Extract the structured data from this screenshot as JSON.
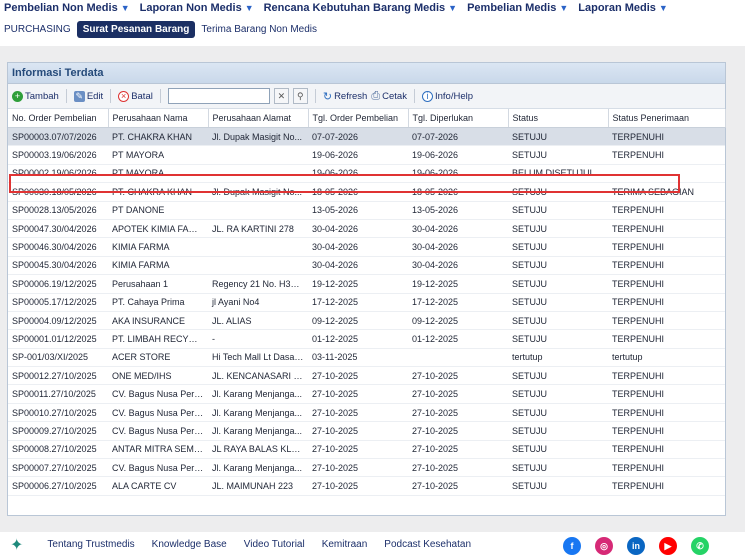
{
  "topnav": [
    {
      "label": "Pembelian Non Medis"
    },
    {
      "label": "Laporan Non Medis"
    },
    {
      "label": "Rencana Kebutuhan Barang Medis"
    },
    {
      "label": "Pembelian Medis"
    },
    {
      "label": "Laporan Medis"
    }
  ],
  "subnav": {
    "purchasing": "PURCHASING",
    "active": "Surat Pesanan Barang",
    "other": "Terima Barang Non Medis"
  },
  "panel": {
    "title": "Informasi Terdata"
  },
  "toolbar": {
    "add": "Tambah",
    "edit": "Edit",
    "cancel": "Batal",
    "search_value": "",
    "refresh": "Refresh",
    "print": "Cetak",
    "info": "Info/Help"
  },
  "table": {
    "headers": [
      "No. Order Pembelian",
      "Perusahaan Nama",
      "Perusahaan Alamat",
      "Tgl. Order Pembelian",
      "Tgl. Diperlukan",
      "Status",
      "Status Penerimaan"
    ],
    "rows": [
      [
        "SP00003.07/07/2026",
        "PT. CHAKRA KHAN",
        "Jl. Dupak Masigit No...",
        "07-07-2026",
        "07-07-2026",
        "SETUJU",
        "TERPENUHI"
      ],
      [
        "SP00003.19/06/2026",
        "PT MAYORA",
        "",
        "19-06-2026",
        "19-06-2026",
        "SETUJU",
        "TERPENUHI"
      ],
      [
        "SP00002.19/06/2026",
        "PT MAYORA",
        "",
        "19-06-2026",
        "19-06-2026",
        "BELUM DISETUJUI",
        ""
      ],
      [
        "SP00030.18/05/2026",
        "PT. CHAKRA KHAN",
        "Jl. Dupak Masigit No...",
        "18-05-2026",
        "18-05-2026",
        "SETUJU",
        "TERIMA SEBAGIAN"
      ],
      [
        "SP00028.13/05/2026",
        "PT DANONE",
        "",
        "13-05-2026",
        "13-05-2026",
        "SETUJU",
        "TERPENUHI"
      ],
      [
        "SP00047.30/04/2026",
        "APOTEK KIMIA FARMA",
        "JL. RA KARTINI 278",
        "30-04-2026",
        "30-04-2026",
        "SETUJU",
        "TERPENUHI"
      ],
      [
        "SP00046.30/04/2026",
        "KIMIA FARMA",
        "",
        "30-04-2026",
        "30-04-2026",
        "SETUJU",
        "TERPENUHI"
      ],
      [
        "SP00045.30/04/2026",
        "KIMIA FARMA",
        "",
        "30-04-2026",
        "30-04-2026",
        "SETUJU",
        "TERPENUHI"
      ],
      [
        "SP00006.19/12/2025",
        "Perusahaan 1",
        "Regency 21 No. H34 ...",
        "19-12-2025",
        "19-12-2025",
        "SETUJU",
        "TERPENUHI"
      ],
      [
        "SP00005.17/12/2025",
        "PT. Cahaya Prima",
        "jl Ayani No4",
        "17-12-2025",
        "17-12-2025",
        "SETUJU",
        "TERPENUHI"
      ],
      [
        "SP00004.09/12/2025",
        "AKA INSURANCE",
        "JL. ALIAS",
        "09-12-2025",
        "09-12-2025",
        "SETUJU",
        "TERPENUHI"
      ],
      [
        "SP00001.01/12/2025",
        "PT. LIMBAH RECYCLE",
        "-",
        "01-12-2025",
        "01-12-2025",
        "SETUJU",
        "TERPENUHI"
      ],
      [
        "SP-001/03/XI/2025",
        "ACER STORE",
        "Hi Tech Mall Lt Dasar...",
        "03-11-2025",
        "",
        "tertutup",
        "tertutup"
      ],
      [
        "SP00012.27/10/2025",
        "ONE MED/IHS",
        "JL. KENCANASARI B...",
        "27-10-2025",
        "27-10-2025",
        "SETUJU",
        "TERPENUHI"
      ],
      [
        "SP00011.27/10/2025",
        "CV. Bagus Nusa Pers...",
        "Jl. Karang Menjanga...",
        "27-10-2025",
        "27-10-2025",
        "SETUJU",
        "TERPENUHI"
      ],
      [
        "SP00010.27/10/2025",
        "CV. Bagus Nusa Pers...",
        "Jl. Karang Menjanga...",
        "27-10-2025",
        "27-10-2025",
        "SETUJU",
        "TERPENUHI"
      ],
      [
        "SP00009.27/10/2025",
        "CV. Bagus Nusa Pers...",
        "Jl. Karang Menjanga...",
        "27-10-2025",
        "27-10-2025",
        "SETUJU",
        "TERPENUHI"
      ],
      [
        "SP00008.27/10/2025",
        "ANTAR MITRA SEMB...",
        "JL RAYA BALAS KLU...",
        "27-10-2025",
        "27-10-2025",
        "SETUJU",
        "TERPENUHI"
      ],
      [
        "SP00007.27/10/2025",
        "CV. Bagus Nusa Pers...",
        "Jl. Karang Menjanga...",
        "27-10-2025",
        "27-10-2025",
        "SETUJU",
        "TERPENUHI"
      ],
      [
        "SP00006.27/10/2025",
        "ALA CARTE CV",
        "JL. MAIMUNAH 223",
        "27-10-2025",
        "27-10-2025",
        "SETUJU",
        "TERPENUHI"
      ]
    ]
  },
  "footer": {
    "links": [
      "Tentang Trustmedis",
      "Knowledge Base",
      "Video Tutorial",
      "Kemitraan",
      "Podcast Kesehatan"
    ],
    "socials": [
      {
        "icon": "facebook-icon",
        "color": "#1877f2"
      },
      {
        "icon": "instagram-icon",
        "color": "#d62976"
      },
      {
        "icon": "linkedin-icon",
        "color": "#0a66c2"
      },
      {
        "icon": "youtube-icon",
        "color": "#ff0000"
      },
      {
        "icon": "whatsapp-icon",
        "color": "#25d366"
      }
    ]
  }
}
